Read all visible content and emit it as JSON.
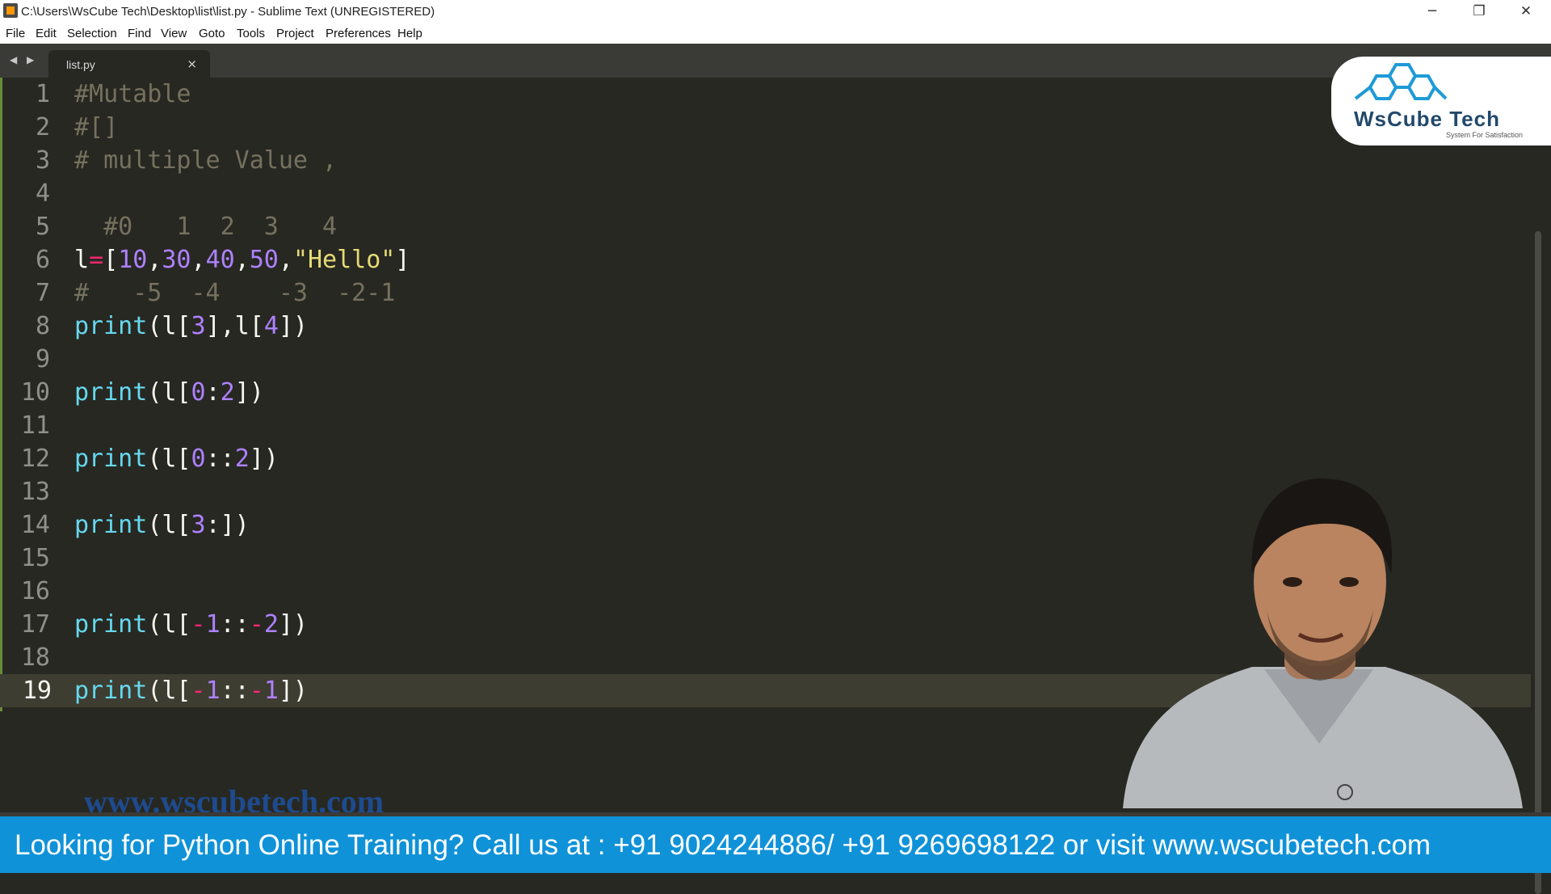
{
  "window": {
    "title": "C:\\Users\\WsCube Tech\\Desktop\\list\\list.py - Sublime Text (UNREGISTERED)",
    "controls": {
      "minimize": "─",
      "restore": "❐",
      "close": "✕"
    }
  },
  "menu": [
    "File",
    "Edit",
    "Selection",
    "Find",
    "View",
    "Goto",
    "Tools",
    "Project",
    "Preferences",
    "Help"
  ],
  "tabs": {
    "nav": "◀ ▶",
    "active": {
      "label": "list.py",
      "close": "×"
    }
  },
  "editor": {
    "active_line": 19,
    "lines": [
      [
        {
          "t": "#Mutable",
          "c": "c"
        }
      ],
      [
        {
          "t": "#[]",
          "c": "c"
        }
      ],
      [
        {
          "t": "# multiple Value ,",
          "c": "c"
        }
      ],
      [],
      [
        {
          "t": "  #0   1  2  3   4",
          "c": "c"
        }
      ],
      [
        {
          "t": "l",
          "c": "p"
        },
        {
          "t": "=",
          "c": "o"
        },
        {
          "t": "[",
          "c": "p"
        },
        {
          "t": "10",
          "c": "n"
        },
        {
          "t": ",",
          "c": "p"
        },
        {
          "t": "30",
          "c": "n"
        },
        {
          "t": ",",
          "c": "p"
        },
        {
          "t": "40",
          "c": "n"
        },
        {
          "t": ",",
          "c": "p"
        },
        {
          "t": "50",
          "c": "n"
        },
        {
          "t": ",",
          "c": "p"
        },
        {
          "t": "\"Hello\"",
          "c": "s"
        },
        {
          "t": "]",
          "c": "p"
        }
      ],
      [
        {
          "t": "#   -5  -4    -3  -2-1",
          "c": "c"
        }
      ],
      [
        {
          "t": "print",
          "c": "f"
        },
        {
          "t": "(l[",
          "c": "p"
        },
        {
          "t": "3",
          "c": "n"
        },
        {
          "t": "],l[",
          "c": "p"
        },
        {
          "t": "4",
          "c": "n"
        },
        {
          "t": "])",
          "c": "p"
        }
      ],
      [],
      [
        {
          "t": "print",
          "c": "f"
        },
        {
          "t": "(l[",
          "c": "p"
        },
        {
          "t": "0",
          "c": "n"
        },
        {
          "t": ":",
          "c": "p"
        },
        {
          "t": "2",
          "c": "n"
        },
        {
          "t": "])",
          "c": "p"
        }
      ],
      [],
      [
        {
          "t": "print",
          "c": "f"
        },
        {
          "t": "(l[",
          "c": "p"
        },
        {
          "t": "0",
          "c": "n"
        },
        {
          "t": "::",
          "c": "p"
        },
        {
          "t": "2",
          "c": "n"
        },
        {
          "t": "])",
          "c": "p"
        }
      ],
      [],
      [
        {
          "t": "print",
          "c": "f"
        },
        {
          "t": "(l[",
          "c": "p"
        },
        {
          "t": "3",
          "c": "n"
        },
        {
          "t": ":])",
          "c": "p"
        }
      ],
      [],
      [],
      [
        {
          "t": "print",
          "c": "f"
        },
        {
          "t": "(l[",
          "c": "p"
        },
        {
          "t": "-",
          "c": "o"
        },
        {
          "t": "1",
          "c": "n"
        },
        {
          "t": "::",
          "c": "p"
        },
        {
          "t": "-",
          "c": "o"
        },
        {
          "t": "2",
          "c": "n"
        },
        {
          "t": "])",
          "c": "p"
        }
      ],
      [],
      [
        {
          "t": "print",
          "c": "f"
        },
        {
          "t": "(l[",
          "c": "p"
        },
        {
          "t": "-",
          "c": "o"
        },
        {
          "t": "1",
          "c": "n"
        },
        {
          "t": "::",
          "c": "p"
        },
        {
          "t": "-",
          "c": "o"
        },
        {
          "t": "1",
          "c": "n"
        },
        {
          "t": "])",
          "c": "p"
        }
      ]
    ]
  },
  "logo": {
    "text": "WsCube Tech",
    "tagline": "System For Satisfaction"
  },
  "watermark": "www.wscubetech.com",
  "banner": "Looking for Python Online Training? Call us at : +91 9024244886/ +91 9269698122 or visit www.wscubetech.com",
  "colors": {
    "editor_bg": "#272822",
    "banner_bg": "#0f92d8",
    "logo_blue": "#22496b"
  }
}
